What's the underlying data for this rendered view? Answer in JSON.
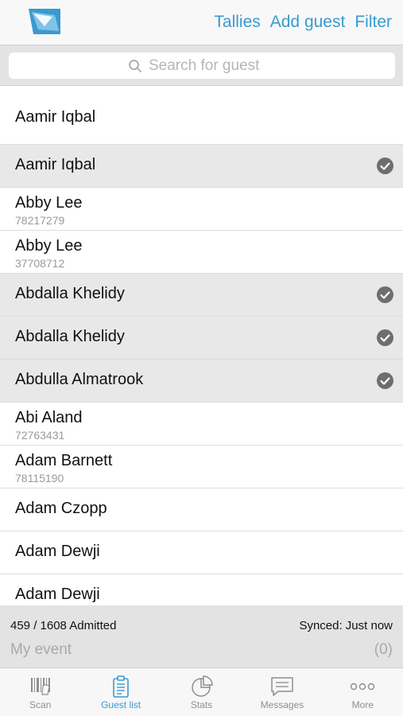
{
  "header": {
    "logo_icon": "app-logo-icon",
    "actions": [
      "Tallies",
      "Add guest",
      "Filter"
    ]
  },
  "search": {
    "placeholder": "Search for guest",
    "icon": "search-icon"
  },
  "guests": [
    {
      "name": "Aamir Iqbal",
      "id": "",
      "admitted": false
    },
    {
      "name": "Aamir Iqbal",
      "id": "",
      "admitted": true
    },
    {
      "name": "Abby Lee",
      "id": "78217279",
      "admitted": false
    },
    {
      "name": "Abby Lee",
      "id": "37708712",
      "admitted": false
    },
    {
      "name": "Abdalla Khelidy",
      "id": "",
      "admitted": true
    },
    {
      "name": "Abdalla Khelidy",
      "id": "",
      "admitted": true
    },
    {
      "name": "Abdulla Almatrook",
      "id": "",
      "admitted": true
    },
    {
      "name": "Abi Aland",
      "id": "72763431",
      "admitted": false
    },
    {
      "name": "Adam Barnett",
      "id": "78115190",
      "admitted": false
    },
    {
      "name": "Adam Czopp",
      "id": "",
      "admitted": false
    },
    {
      "name": "Adam Dewji",
      "id": "",
      "admitted": false
    },
    {
      "name": "Adam Dewji",
      "id": "",
      "admitted": false
    }
  ],
  "status": {
    "admitted": "459 / 1608 Admitted",
    "synced": "Synced: Just now",
    "event_name": "My event",
    "event_count": "(0)"
  },
  "tabs": [
    {
      "label": "Scan",
      "icon": "barcode-scan-icon",
      "active": false
    },
    {
      "label": "Guest list",
      "icon": "clipboard-icon",
      "active": true
    },
    {
      "label": "Stats",
      "icon": "pie-chart-icon",
      "active": false
    },
    {
      "label": "Messages",
      "icon": "message-bubble-icon",
      "active": false
    },
    {
      "label": "More",
      "icon": "more-dots-icon",
      "active": false
    }
  ],
  "colors": {
    "accent": "#3a9ad0",
    "check": "#6e6e6e",
    "admitted_row": "#e8e8e8"
  }
}
